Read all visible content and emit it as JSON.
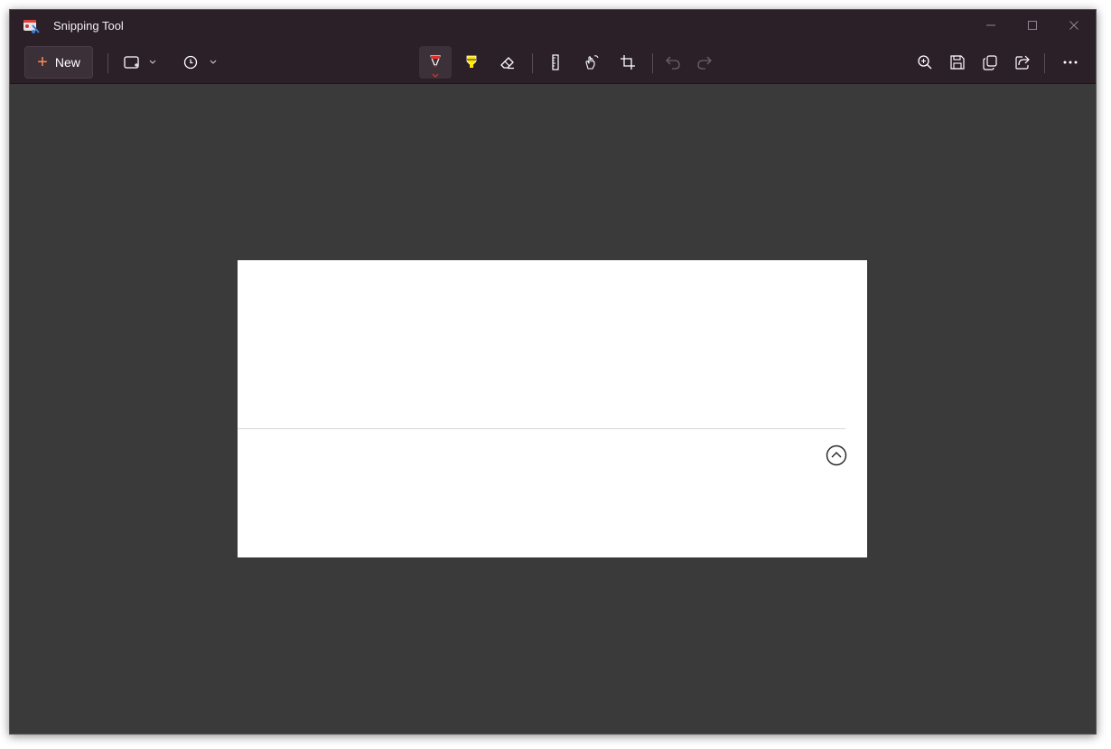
{
  "window": {
    "title": "Snipping Tool"
  },
  "toolbar": {
    "new_label": "New",
    "snip_mode_icon": "rectangle-snip-icon",
    "delay_icon": "clock-icon",
    "tools": [
      "ballpoint-pen-icon",
      "highlighter-icon",
      "eraser-icon",
      "ruler-icon",
      "touch-writing-icon",
      "crop-icon",
      "undo-icon",
      "redo-icon"
    ],
    "actions": [
      "zoom-icon",
      "save-icon",
      "copy-icon",
      "share-icon",
      "more-icon"
    ]
  },
  "colors": {
    "titlebar": "#2b1f28",
    "canvas_bg": "#3a3a3a",
    "accent_pen": "#e0342b",
    "accent_highlighter": "#ffe600",
    "new_plus": "#ff8a50"
  }
}
